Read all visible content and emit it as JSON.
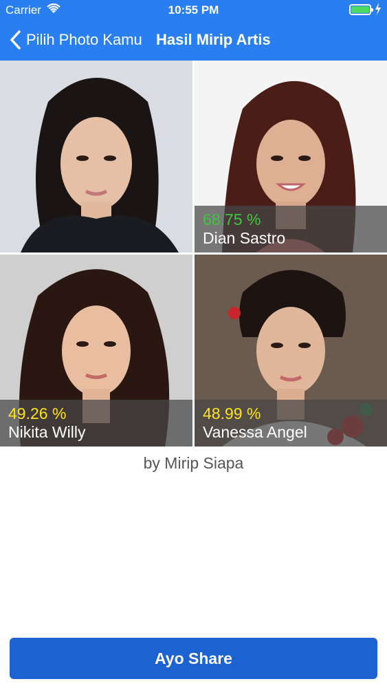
{
  "status_bar": {
    "carrier": "Carrier",
    "time": "10:55 PM",
    "wifi_icon": "wifi-icon",
    "battery_icon": "battery-icon",
    "charging_icon": "bolt-icon"
  },
  "nav": {
    "back_label": "Pilih Photo Kamu",
    "back_icon": "chevron-left-icon",
    "title": "Hasil Mirip Artis"
  },
  "results": {
    "user_photo": "user-photo",
    "matches": [
      {
        "percent": "68.75 %",
        "name": "Dian Sastro",
        "percent_color": "#3fc63f"
      },
      {
        "percent": "49.26 %",
        "name": "Nikita Willy",
        "percent_color": "#ffe21a"
      },
      {
        "percent": "48.99 %",
        "name": "Vanessa Angel",
        "percent_color": "#ffe21a"
      }
    ]
  },
  "footer": {
    "credit": "by Mirip Siapa",
    "share_label": "Ayo Share"
  },
  "colors": {
    "nav_blue": "#2a7ff0",
    "button_blue": "#1c62d0",
    "overlay": "rgba(70,70,70,0.72)"
  }
}
